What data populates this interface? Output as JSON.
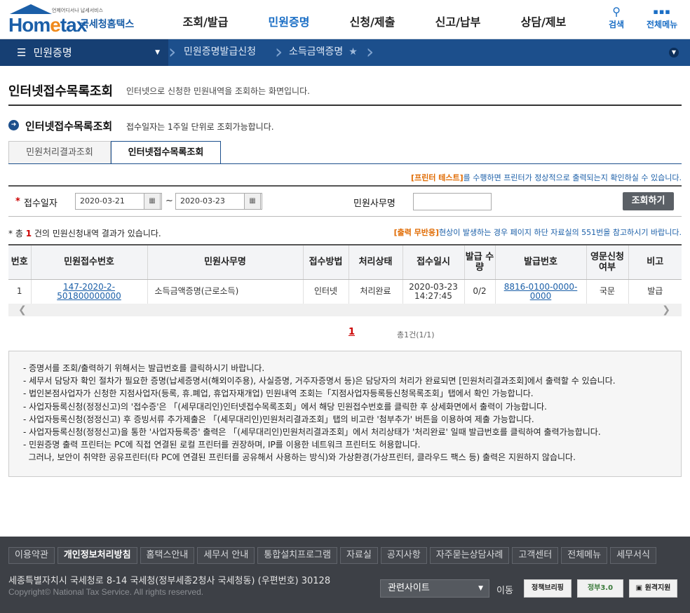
{
  "header": {
    "logo_sub": "언제어디서나 납세서비스",
    "logo_home": "Hom",
    "logo_e": "e",
    "logo_tax": "tax",
    "logo_kr": "국세청홈택스",
    "gnb": [
      "조회/발급",
      "민원증명",
      "신청/제출",
      "신고/납부",
      "상담/제보"
    ],
    "search_label": "검색",
    "allmenu_label": "전체메뉴"
  },
  "locbar": {
    "menu_label": "민원증명",
    "crumb1": "민원증명발급신청",
    "crumb2": "소득금액증명"
  },
  "page": {
    "title": "인터넷접수목록조회",
    "desc": "인터넷으로 신청한 민원내역을 조회하는 화면입니다.",
    "section_title": "인터넷접수목록조회",
    "section_desc": "접수일자는 1주일 단위로 조회가능합니다."
  },
  "tabs": [
    "민원처리결과조회",
    "인터넷접수목록조회"
  ],
  "print_note": {
    "highlight": "[프린터 테스트]",
    "text": "를 수행하면 프린터가 정상적으로 출력되는지 확인하실 수 있습니다."
  },
  "search": {
    "date_label": "접수일자",
    "date_from": "2020-03-21",
    "date_to": "2020-03-23",
    "tilde": "~",
    "name_label": "민원사무명",
    "name_value": "",
    "button": "조회하기"
  },
  "result": {
    "prefix": "* 총",
    "count": "1",
    "suffix": "건의 민원신청내역 결과가 있습니다.",
    "output_highlight": "[출력 무반응]",
    "output_text": "현상이 발생하는 경우 페이지 하단 자료실의 551번을 참고하시기 바랍니다."
  },
  "table": {
    "headers": [
      "번호",
      "민원접수번호",
      "민원사무명",
      "접수방법",
      "처리상태",
      "접수일시",
      "발급 수량",
      "발급번호",
      "영문신청 여부",
      "비고"
    ],
    "rows": [
      {
        "no": "1",
        "receipt_no": "147-2020-2-501800000000",
        "name": "소득금액증명(근로소득)",
        "method": "인터넷",
        "status": "처리완료",
        "date": "2020-03-23",
        "time": "14:27:45",
        "qty": "0/2",
        "issue_no": "8816-0100-0000-0000",
        "english": "국문",
        "note": "발급"
      }
    ]
  },
  "pager": {
    "current": "1",
    "total": "총1건(1/1)"
  },
  "notice": [
    "- 증명서를 조회/출력하기 위해서는 발급번호를 클릭하시기 바랍니다.",
    "- 세무서 담당자 확인 절차가 필요한 증명(납세증명서(해외이주용), 사실증명, 거주자증명서 등)은 담당자의 처리가 완료되면 [민원처리결과조회]에서 출력할 수 있습니다.",
    "- 법인본점사업자가 신청한 지점사업자(등록, 휴.폐업, 휴업자재개업) 민원내역 조회는「지점사업자등록등신청목록조회」탭에서 확인 가능합니다.",
    "- 사업자등록신청(정정신고)의 '접수증'은 「(세무대리인)인터넷접수목록조회」에서 해당 민원접수번호를 클릭한 후 상세화면에서 출력이 가능합니다.",
    "- 사업자등록신청(정정신고) 후 증빙서류 추가제출은 「(세무대리인)민원처리결과조회」탭의 비고란 '첨부추가' 버튼을 이용하여 제출 가능합니다.",
    "- 사업자등록신청(정정신고)을 통한 '사업자등록증' 출력은 「(세무대리인)민원처리결과조회」에서 처리상태가 '처리완료' 일때 발급번호를 클릭하여 출력가능합니다.",
    "- 민원증명 출력 프린터는 PC에 직접 연결된 로컬 프린터를 권장하며, IP를 이용한 네트워크 프린터도 허용합니다.",
    "  그러나, 보안이 취약한 공유프린터(타 PC에 연결된 프린터를 공유해서 사용하는 방식)와 가상환경(가상프린터, 클라우드 팩스 등) 출력은 지원하지 않습니다."
  ],
  "footer": {
    "links": [
      "이용약관",
      "개인정보처리방침",
      "홈택스안내",
      "세무서 안내",
      "통합설치프로그램",
      "자료실",
      "공지사항",
      "자주묻는상담사례",
      "고객센터",
      "전체메뉴",
      "세무서식"
    ],
    "address": "세종특별자치시 국세청로 8-14 국세청(정부세종2청사 국세청동) (우편번호) 30128",
    "copyright": "Copyright© National Tax Service. All rights reserved.",
    "select_label": "관련사이트",
    "go_label": "이동",
    "badge1": "정책브리핑",
    "badge2": "정부3.0",
    "badge3": "원격지원"
  },
  "colors": {
    "brand": "#1c4f8c",
    "accent": "#1a6ec5",
    "alert": "#e06a00",
    "footer_bg": "#3d4046"
  }
}
